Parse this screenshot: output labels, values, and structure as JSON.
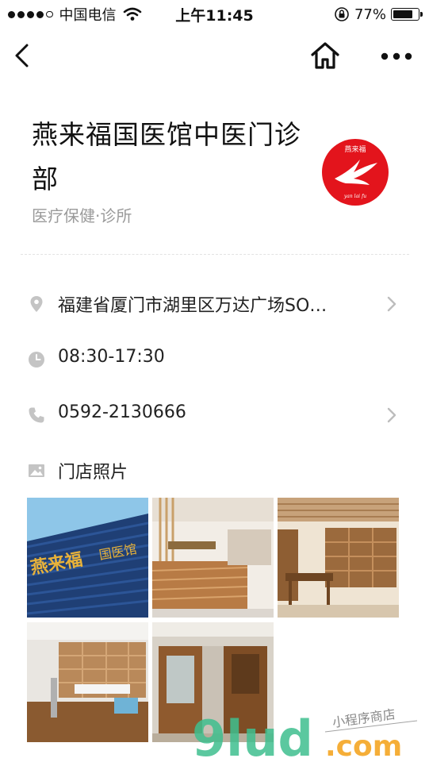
{
  "status_bar": {
    "carrier": "中国电信",
    "time": "上午11:45",
    "battery": "77%",
    "battery_level": 0.77
  },
  "nav": {
    "back_icon": "chevron-left-icon",
    "home_icon": "home-icon",
    "more_icon": "more-dots-icon"
  },
  "shop": {
    "title": "燕来福国医馆中医门诊部",
    "category": "医疗保健·诊所",
    "logo_color": "#e3141c"
  },
  "info": {
    "address": "福建省厦门市湖里区万达广场SO…",
    "hours": "08:30-17:30",
    "phone": "0592-2130666",
    "photos_label": "门店照片"
  },
  "photos": [
    {
      "name": "store-photo-facade",
      "icon": "building-photo"
    },
    {
      "name": "store-photo-reception",
      "icon": "reception-photo"
    },
    {
      "name": "store-photo-room",
      "icon": "room-photo"
    },
    {
      "name": "store-photo-treatment",
      "icon": "treatment-photo"
    },
    {
      "name": "store-photo-door",
      "icon": "door-photo"
    }
  ],
  "watermark": {
    "brand": "9lud",
    "suffix": ".com",
    "tagline": "小程序商店",
    "brand_color": "#3fbf8f",
    "suffix_color": "#f5a623"
  },
  "colors": {
    "icon_gray": "#c4c4c4",
    "text_gray": "#9a9a9a"
  }
}
